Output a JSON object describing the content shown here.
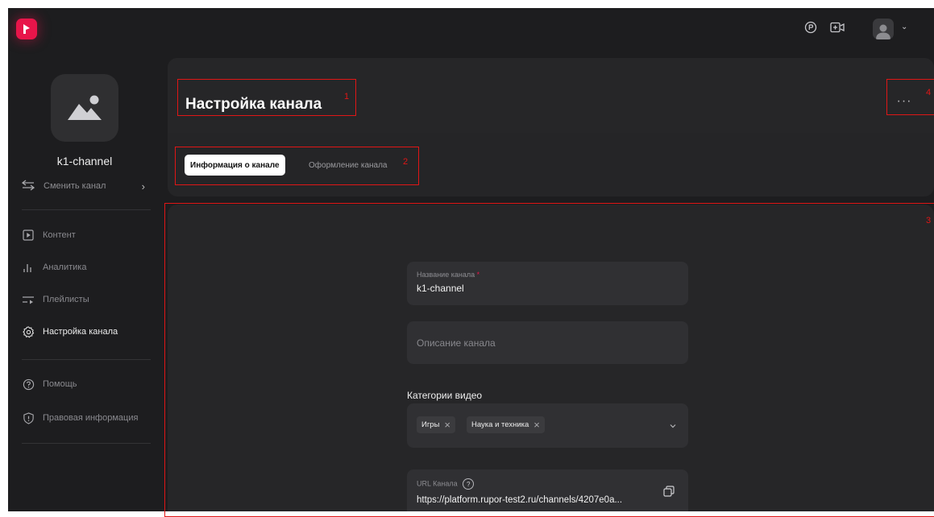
{
  "header": {
    "title": "Настройка канала",
    "more_label": "···"
  },
  "sidebar": {
    "channel_name": "k1-channel",
    "switch_label": "Сменить канал",
    "items": [
      {
        "label": "Контент",
        "icon": "play-square-icon"
      },
      {
        "label": "Аналитика",
        "icon": "bar-chart-icon"
      },
      {
        "label": "Плейлисты",
        "icon": "playlist-icon"
      },
      {
        "label": "Настройка канала",
        "icon": "gear-icon",
        "active": true
      },
      {
        "label": "Помощь",
        "icon": "help-circle-icon"
      },
      {
        "label": "Правовая информация",
        "icon": "shield-icon"
      }
    ]
  },
  "tabs": [
    {
      "label": "Информация о канале",
      "active": true
    },
    {
      "label": "Оформление канала",
      "active": false
    }
  ],
  "form": {
    "name_label": "Название канала",
    "name_required_mark": "*",
    "name_value": "k1-channel",
    "description_placeholder": "Описание канала",
    "categories_heading": "Категории видео",
    "categories": [
      "Игры",
      "Наука и техника"
    ],
    "url_label": "URL Канала",
    "url_value": "https://platform.rupor-test2.ru/channels/4207e0a..."
  },
  "annotations": [
    "1",
    "2",
    "3",
    "4"
  ],
  "colors": {
    "accent": "#e8154a",
    "background": "#1d1d1f",
    "card": "#262628",
    "annotation": "#e01616"
  }
}
